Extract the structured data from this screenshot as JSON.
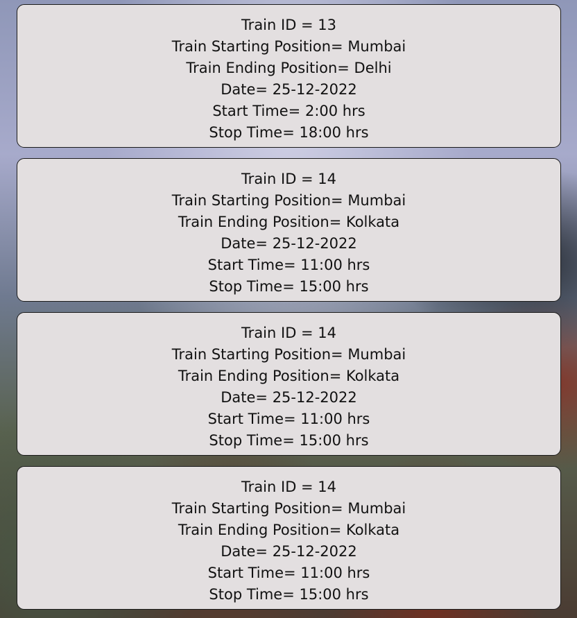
{
  "trains": [
    {
      "id_text": "Train ID = 13",
      "start_text": "Train Starting Position= Mumbai",
      "end_text": "Train Ending Position= Delhi",
      "date_text": "Date= 25-12-2022",
      "start_time_text": "Start Time= 2:00 hrs",
      "stop_time_text": "Stop Time= 18:00 hrs"
    },
    {
      "id_text": "Train ID = 14",
      "start_text": "Train Starting Position= Mumbai",
      "end_text": "Train Ending Position= Kolkata",
      "date_text": "Date= 25-12-2022",
      "start_time_text": "Start Time= 11:00 hrs",
      "stop_time_text": "Stop Time= 15:00 hrs"
    },
    {
      "id_text": "Train ID = 14",
      "start_text": "Train Starting Position= Mumbai",
      "end_text": "Train Ending Position= Kolkata",
      "date_text": "Date= 25-12-2022",
      "start_time_text": "Start Time= 11:00 hrs",
      "stop_time_text": "Stop Time= 15:00 hrs"
    },
    {
      "id_text": "Train ID = 14",
      "start_text": "Train Starting Position= Mumbai",
      "end_text": "Train Ending Position= Kolkata",
      "date_text": "Date= 25-12-2022",
      "start_time_text": "Start Time= 11:00 hrs",
      "stop_time_text": "Stop Time= 15:00 hrs"
    }
  ],
  "colors": {
    "card_background": "#e3dfe0",
    "card_border": "#1a1a1a",
    "text": "#111111"
  }
}
